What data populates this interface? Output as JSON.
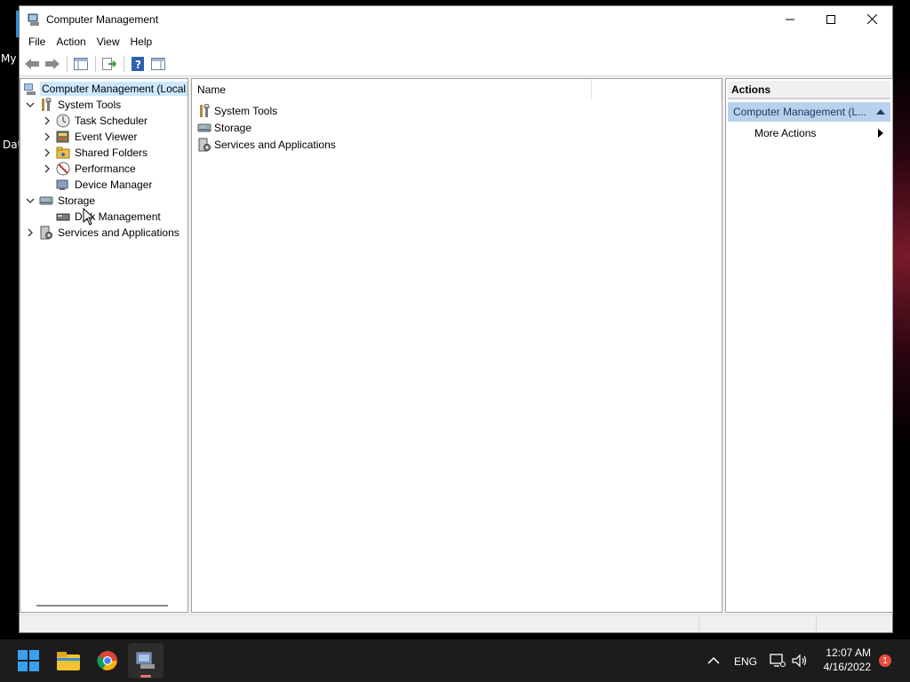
{
  "window": {
    "title": "Computer Management",
    "menu": [
      "File",
      "Action",
      "View",
      "Help"
    ]
  },
  "tree": {
    "items": [
      {
        "label": "Computer Management (Local",
        "icon": "computer-management-icon",
        "expander": "",
        "selected": true
      },
      {
        "label": "System Tools",
        "icon": "system-tools-icon",
        "expander": "expanded"
      },
      {
        "label": "Task Scheduler",
        "icon": "clock-icon",
        "expander": "collapsed"
      },
      {
        "label": "Event Viewer",
        "icon": "event-viewer-icon",
        "expander": "collapsed"
      },
      {
        "label": "Shared Folders",
        "icon": "shared-folders-icon",
        "expander": "collapsed"
      },
      {
        "label": "Performance",
        "icon": "performance-icon",
        "expander": "collapsed"
      },
      {
        "label": "Device Manager",
        "icon": "device-manager-icon",
        "expander": ""
      },
      {
        "label": "Storage",
        "icon": "storage-icon",
        "expander": "expanded"
      },
      {
        "label": "Disk Management",
        "icon": "disk-management-icon",
        "expander": ""
      },
      {
        "label": "Services and Applications",
        "icon": "services-icon",
        "expander": "collapsed"
      }
    ]
  },
  "list": {
    "column_name": "Name",
    "rows": [
      {
        "label": "System Tools",
        "icon": "system-tools-icon"
      },
      {
        "label": "Storage",
        "icon": "storage-icon"
      },
      {
        "label": "Services and Applications",
        "icon": "services-icon"
      }
    ]
  },
  "actions": {
    "title": "Actions",
    "section": "Computer Management (L...",
    "more": "More Actions"
  },
  "desktop": {
    "label_top": "My",
    "label_mid": "Dat"
  },
  "taskbar": {
    "language": "ENG",
    "time": "12:07 AM",
    "date": "4/16/2022",
    "notification_count": "1"
  }
}
